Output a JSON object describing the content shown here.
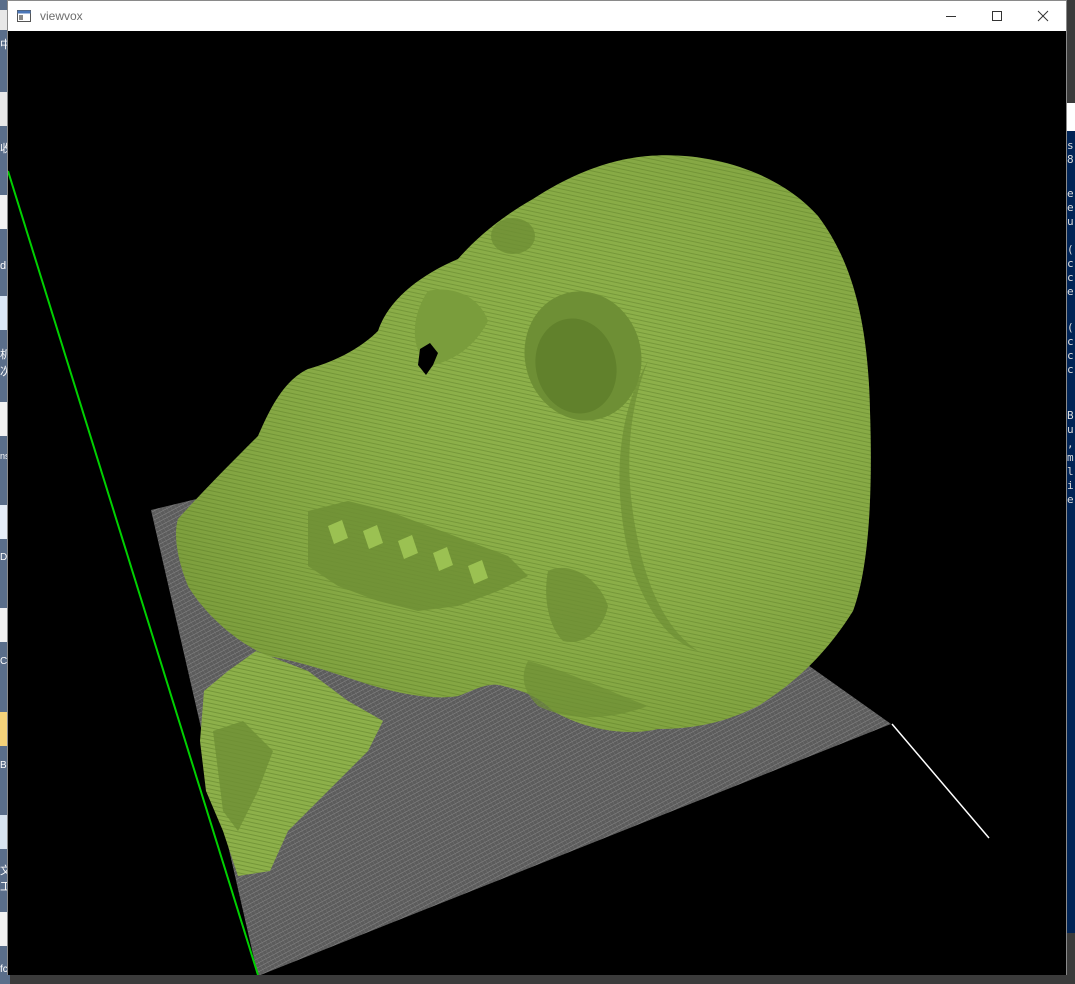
{
  "window": {
    "title": "viewvox",
    "controls": {
      "minimize": "minimize",
      "maximize": "maximize",
      "close": "close"
    }
  },
  "desktop": {
    "fragments": [
      "中",
      "收",
      "d",
      "机",
      "次",
      "ns",
      "DE",
      "CO",
      "BC",
      "文",
      "工",
      "fc"
    ]
  },
  "console": {
    "fragments": [
      "s",
      "8",
      "e",
      "e",
      "u",
      "(",
      "c",
      "c",
      "e",
      "(",
      "c",
      "c",
      "c",
      "B",
      "u",
      ",",
      "m",
      "l",
      "i",
      "e"
    ]
  },
  "scene": {
    "background": "#000000",
    "model_color": "#8db04a",
    "model_shadow": "#6e8f35",
    "grid_color": "#7a7a7a",
    "axis_green": "#00d000",
    "axis_white": "#ffffff",
    "model": "voxel skull"
  }
}
